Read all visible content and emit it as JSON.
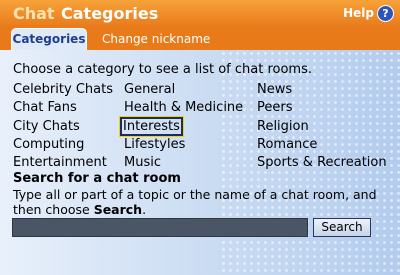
{
  "title": {
    "app": "Chat",
    "page": "Categories",
    "help_label": "Help",
    "help_icon": "question-icon"
  },
  "tabs": [
    {
      "label": "Categories",
      "active": true
    },
    {
      "label": "Change nickname",
      "active": false
    }
  ],
  "intro": "Choose a category to see a list of chat rooms.",
  "categories": {
    "col1": [
      "Celebrity Chats",
      "Chat Fans",
      "City Chats",
      "Computing",
      "Entertainment"
    ],
    "col2": [
      "General",
      "Health & Medicine",
      "Interests",
      "Lifestyles",
      "Music"
    ],
    "col3": [
      "News",
      "Peers",
      "Religion",
      "Romance",
      "Sports & Recreation"
    ],
    "focused": "Interests"
  },
  "search": {
    "heading": "Search for a chat room",
    "desc_prefix": "Type all or part of a topic or the name of a chat room, and then choose ",
    "desc_bold": "Search",
    "desc_suffix": ".",
    "value": "",
    "button_label": "Search"
  },
  "colors": {
    "accent": "#e97a1a",
    "background": "#c9dcf3",
    "focus": "#1c2a66"
  }
}
